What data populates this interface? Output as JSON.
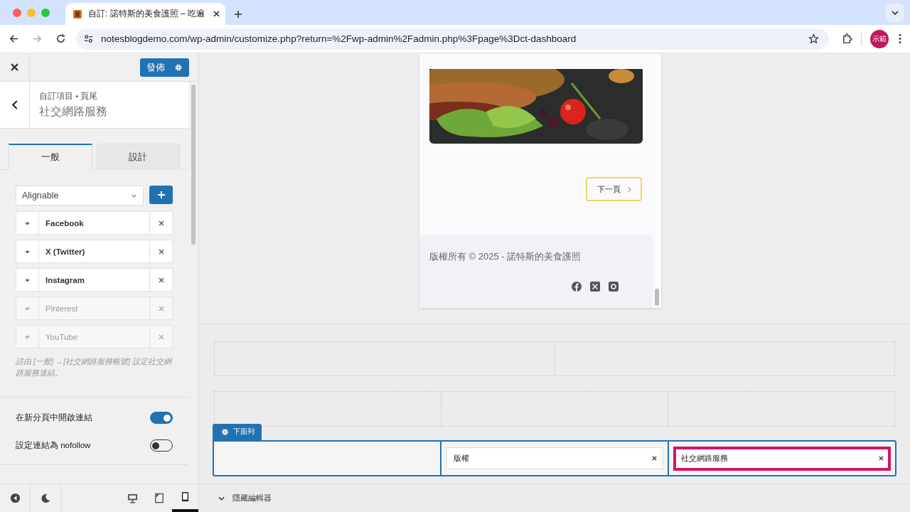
{
  "browser": {
    "tab_title": "自訂: 諾特斯的美食護照 – 吃遍",
    "url": "notesblogdemo.com/wp-admin/customize.php?return=%2Fwp-admin%2Fadmin.php%3Fpage%3Dct-dashboard",
    "profile": "示範"
  },
  "sidebar": {
    "publish": "發佈",
    "breadcrumb": "自訂項目 • 頁尾",
    "title": "社交網路服務",
    "tabs": [
      {
        "label": "一般",
        "selected": true
      },
      {
        "label": "設計",
        "selected": false
      }
    ],
    "select": "Alignable",
    "networks": [
      {
        "name": "Facebook",
        "visible": true
      },
      {
        "name": "X (Twitter)",
        "visible": true
      },
      {
        "name": "Instagram",
        "visible": true
      },
      {
        "name": "Pinterest",
        "visible": false
      },
      {
        "name": "YouTube",
        "visible": false
      }
    ],
    "hint": "請由 [一般] →[社交網路服務帳號] 設定社交網路服務連結。",
    "toggles": [
      {
        "label": "在新分頁中開啟連結",
        "on": true
      },
      {
        "label": "設定連結為 nofollow",
        "on": false
      }
    ],
    "devices": [
      {
        "kind": "desktop",
        "selected": false
      },
      {
        "kind": "tablet",
        "selected": false
      },
      {
        "kind": "mobile",
        "selected": true
      }
    ]
  },
  "preview": {
    "next_button": "下一頁",
    "copyright": "版權所有 © 2025 - 諾特斯的美食護照"
  },
  "builder": {
    "row_label": "下面列",
    "cells": [
      {
        "kind": "empty"
      },
      {
        "kind": "item",
        "label": "版權",
        "highlighted": false
      },
      {
        "kind": "item",
        "label": "社交網路服務",
        "highlighted": true
      }
    ]
  },
  "hide_editor": "隱藏編輯器"
}
